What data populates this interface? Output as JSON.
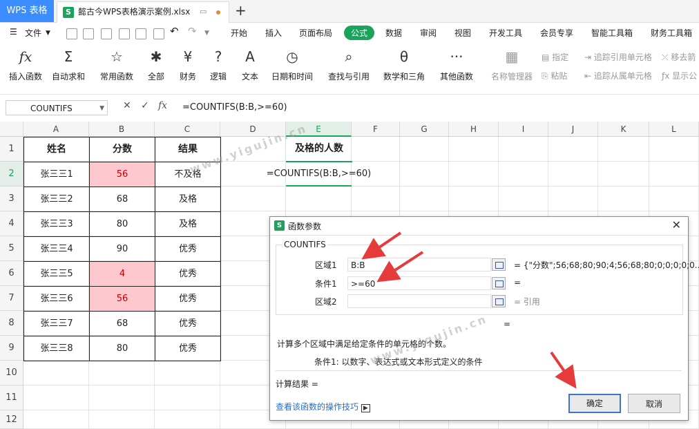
{
  "titlebar": {
    "app": "WPS 表格",
    "doc_badge": "S",
    "doc_name": "懿古今WPS表格演示案例.xlsx",
    "new_tab": "+"
  },
  "menubar": {
    "file": "文件",
    "tabs": [
      "开始",
      "插入",
      "页面布局",
      "公式",
      "数据",
      "审阅",
      "视图",
      "开发工具",
      "会员专享",
      "智能工具箱",
      "财务工具箱"
    ]
  },
  "ribbon": {
    "items": [
      {
        "icon": "fx",
        "label": "插入函数"
      },
      {
        "icon": "Σ",
        "label": "自动求和"
      },
      {
        "icon": "☆",
        "label": "常用函数"
      },
      {
        "icon": "✱",
        "label": "全部"
      },
      {
        "icon": "¥",
        "label": "财务"
      },
      {
        "icon": "?",
        "label": "逻辑"
      },
      {
        "icon": "A",
        "label": "文本"
      },
      {
        "icon": "◷",
        "label": "日期和时间"
      },
      {
        "icon": "⌕",
        "label": "查找与引用"
      },
      {
        "icon": "θ",
        "label": "数学和三角"
      },
      {
        "icon": "···",
        "label": "其他函数"
      },
      {
        "icon": "▦",
        "label": "名称管理器"
      }
    ],
    "small": [
      "指定",
      "粘贴",
      "追踪引用单元格",
      "追踪从属单元格",
      "移去箭",
      "显示公"
    ]
  },
  "formula_bar": {
    "name_box": "COUNTIFS",
    "formula": "=COUNTIFS(B:B,>=60)"
  },
  "grid": {
    "columns": [
      "A",
      "B",
      "C",
      "D",
      "E",
      "F",
      "G",
      "H",
      "I",
      "J",
      "K",
      "L"
    ],
    "rows": [
      "1",
      "2",
      "3",
      "4",
      "5",
      "6",
      "7",
      "8",
      "9",
      "10",
      "11",
      "12"
    ],
    "headers": [
      "姓名",
      "分数",
      "结果"
    ],
    "data": [
      [
        "张三三1",
        "56",
        "不及格"
      ],
      [
        "张三三2",
        "68",
        "及格"
      ],
      [
        "张三三3",
        "80",
        "及格"
      ],
      [
        "张三三4",
        "90",
        "优秀"
      ],
      [
        "张三三5",
        "4",
        "优秀"
      ],
      [
        "张三三6",
        "56",
        "优秀"
      ],
      [
        "张三三7",
        "68",
        "优秀"
      ],
      [
        "张三三8",
        "80",
        "优秀"
      ]
    ],
    "e1": "及格的人数",
    "e2": "=COUNTIFS(B:B,>=60)",
    "watermark": "www.yigujin.cn"
  },
  "dialog": {
    "title": "函数参数",
    "function": "COUNTIFS",
    "args": [
      {
        "label": "区域1",
        "value": "B:B",
        "result": "= {\"分数\";56;68;80;90;4;56;68;80;0;0;0;0;0..."
      },
      {
        "label": "条件1",
        "value": ">=60",
        "result": "="
      },
      {
        "label": "区域2",
        "value": "",
        "result": "= 引用"
      }
    ],
    "eq": "=",
    "desc": "计算多个区域中满足给定条件的单元格的个数。",
    "arg_help": "条件1:  以数字、表达式或文本形式定义的条件",
    "calc_result": "计算结果 =",
    "help_link": "查看该函数的操作技巧",
    "ok": "确定",
    "cancel": "取消",
    "watermark": "www.yigujin.cn"
  }
}
